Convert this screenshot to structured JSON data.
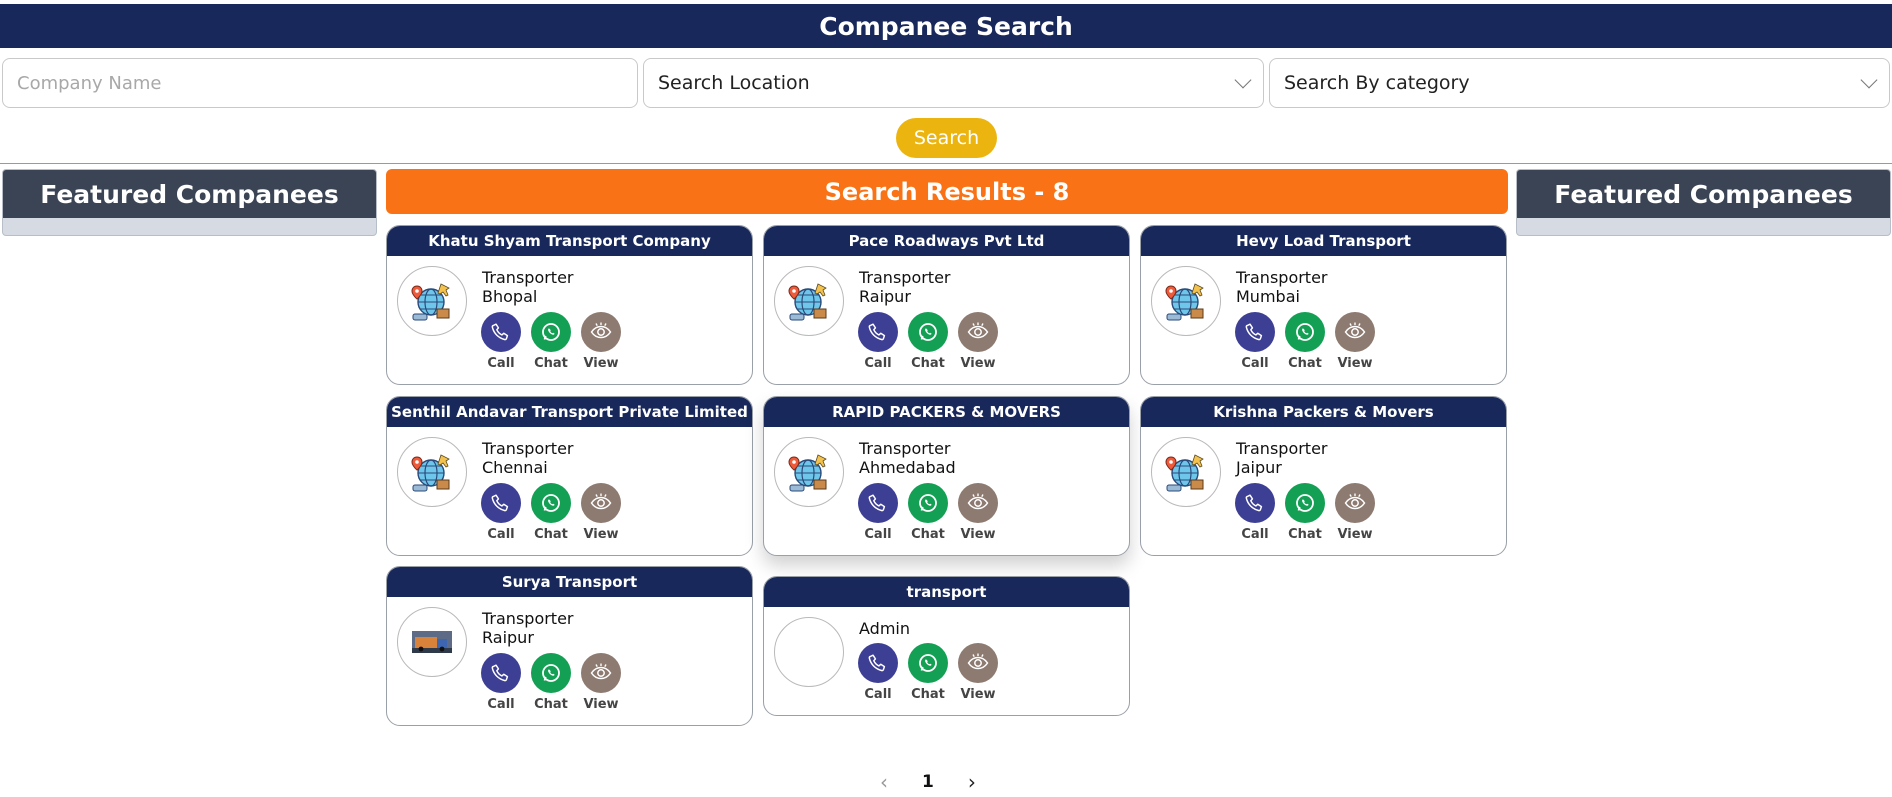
{
  "header": {
    "title": "Companee Search"
  },
  "search": {
    "company_placeholder": "Company Name",
    "location_value": "Search Location",
    "category_value": "Search By category",
    "button_label": "Search"
  },
  "featured": {
    "left_title": "Featured Companees",
    "right_title": "Featured Companees"
  },
  "results": {
    "title": "Search Results - 8",
    "actions": {
      "call": "Call",
      "chat": "Chat",
      "view": "View"
    },
    "cards": [
      {
        "name": "Khatu Shyam Transport Company",
        "category": "Transporter",
        "city": "Bhopal",
        "logo": "globe-delivery-icon"
      },
      {
        "name": "Pace Roadways Pvt Ltd",
        "category": "Transporter",
        "city": "Raipur",
        "logo": "globe-delivery-icon"
      },
      {
        "name": "Hevy Load Transport",
        "category": "Transporter",
        "city": "Mumbai",
        "logo": "globe-delivery-icon"
      },
      {
        "name": "Senthil Andavar Transport Private Limited",
        "category": "Transporter",
        "city": "Chennai",
        "logo": "globe-delivery-icon"
      },
      {
        "name": "RAPID PACKERS & MOVERS",
        "category": "Transporter",
        "city": "Ahmedabad",
        "logo": "globe-delivery-icon"
      },
      {
        "name": "Krishna Packers & Movers",
        "category": "Transporter",
        "city": "Jaipur",
        "logo": "globe-delivery-icon"
      },
      {
        "name": "Surya Transport",
        "category": "Transporter",
        "city": "Raipur",
        "logo": "truck-photo-icon"
      },
      {
        "name": "transport",
        "category": "Admin",
        "city": "",
        "logo": "empty-logo"
      }
    ]
  },
  "pagination": {
    "prev": "‹",
    "page": "1",
    "next": "›"
  },
  "colors": {
    "navy": "#18285a",
    "orange": "#f97316",
    "yellow": "#ecb40e",
    "call": "#3d3f94",
    "chat": "#13a054",
    "view": "#8d7a70"
  }
}
